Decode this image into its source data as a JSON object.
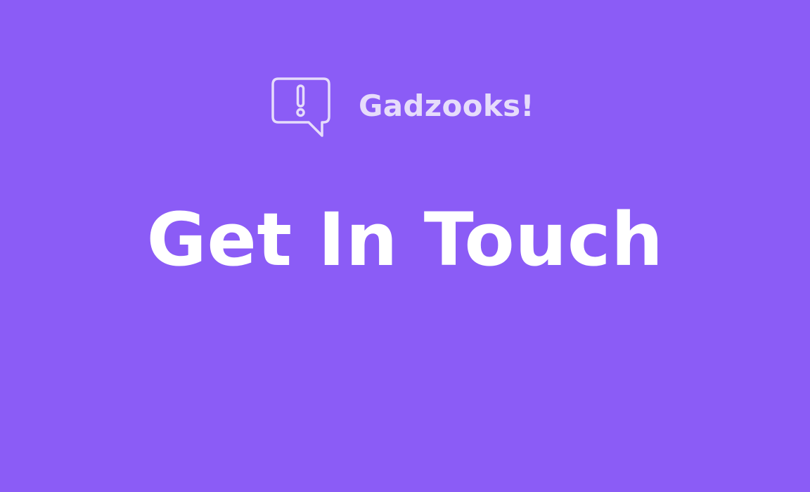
{
  "brand": {
    "name": "Gadzooks!",
    "icon": "speech-bubble-exclamation-icon"
  },
  "hero": {
    "title": "Get In Touch"
  },
  "colors": {
    "background": "#8b5cf6",
    "brand_text": "#e6dcfb",
    "title_text": "#ffffff"
  }
}
